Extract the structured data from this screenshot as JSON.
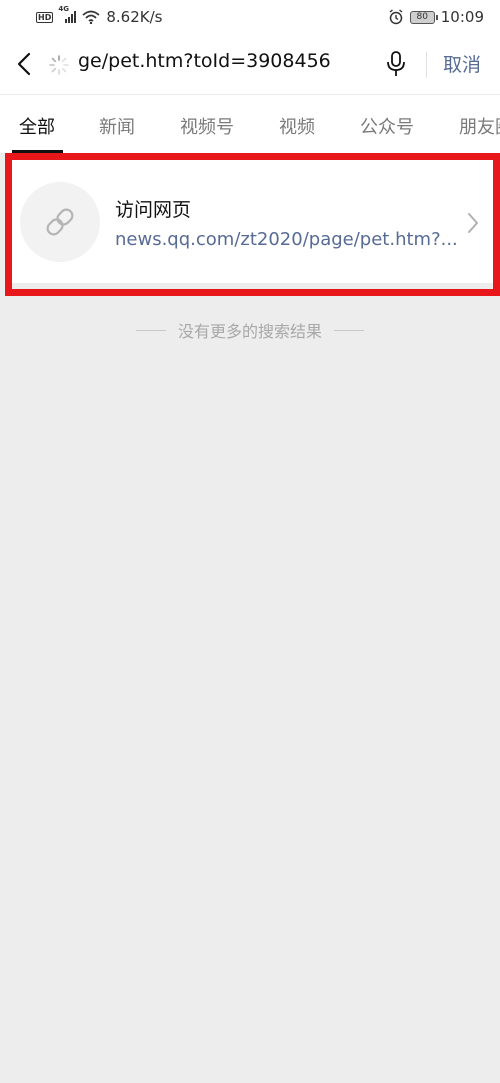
{
  "status_bar": {
    "network_speed": "8.62K/s",
    "battery": "80",
    "time": "10:09",
    "hd_label": "HD",
    "network_label": "4G"
  },
  "search": {
    "query": "ge/pet.htm?toId=3908456",
    "cancel_label": "取消"
  },
  "tabs": [
    {
      "label": "全部",
      "active": true
    },
    {
      "label": "新闻"
    },
    {
      "label": "视频号"
    },
    {
      "label": "视频"
    },
    {
      "label": "公众号"
    },
    {
      "label": "朋友圈"
    }
  ],
  "result": {
    "title": "访问网页",
    "url": "news.qq.com/zt2020/page/pet.htm?..."
  },
  "footer": {
    "no_more_text": "没有更多的搜索结果"
  },
  "colors": {
    "accent": "#576b95",
    "highlight": "#e8171c",
    "background": "#ededed"
  }
}
